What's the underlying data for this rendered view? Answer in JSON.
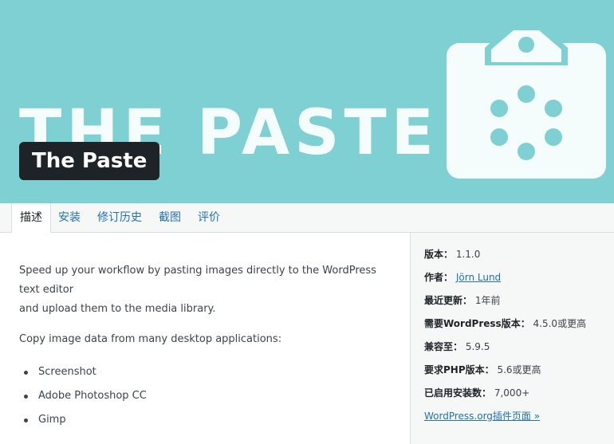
{
  "banner": {
    "big_text": "THE PASTE"
  },
  "plugin": {
    "name": "The Paste"
  },
  "tabs": [
    {
      "label": "描述",
      "active": true
    },
    {
      "label": "安装",
      "active": false
    },
    {
      "label": "修订历史",
      "active": false
    },
    {
      "label": "截图",
      "active": false
    },
    {
      "label": "评价",
      "active": false
    }
  ],
  "description": {
    "intro_line1": "Speed up your workflow by pasting images directly to the WordPress text editor",
    "intro_line2": "and upload them to the media library.",
    "copy_intro": "Copy image data from many desktop applications:",
    "apps": [
      "Screenshot",
      "Adobe Photoshop CC",
      "Gimp"
    ]
  },
  "meta": {
    "version": {
      "label": "版本：",
      "value": "1.1.0"
    },
    "author": {
      "label": "作者：",
      "value": "Jörn Lund"
    },
    "updated": {
      "label": "最近更新：",
      "value": "1年前"
    },
    "wp_required": {
      "label": "需要WordPress版本：",
      "value": "4.5.0或更高"
    },
    "compatible": {
      "label": "兼容至：",
      "value": "5.9.5"
    },
    "php_required": {
      "label": "要求PHP版本：",
      "value": "5.6或更高"
    },
    "installs": {
      "label": "已启用安装数：",
      "value": "7,000+"
    },
    "plugin_page_link": "WordPress.org插件页面 »"
  },
  "colors": {
    "banner_bg": "#7ed0d3",
    "title_bg": "#1d2327",
    "link": "#2271b1"
  }
}
